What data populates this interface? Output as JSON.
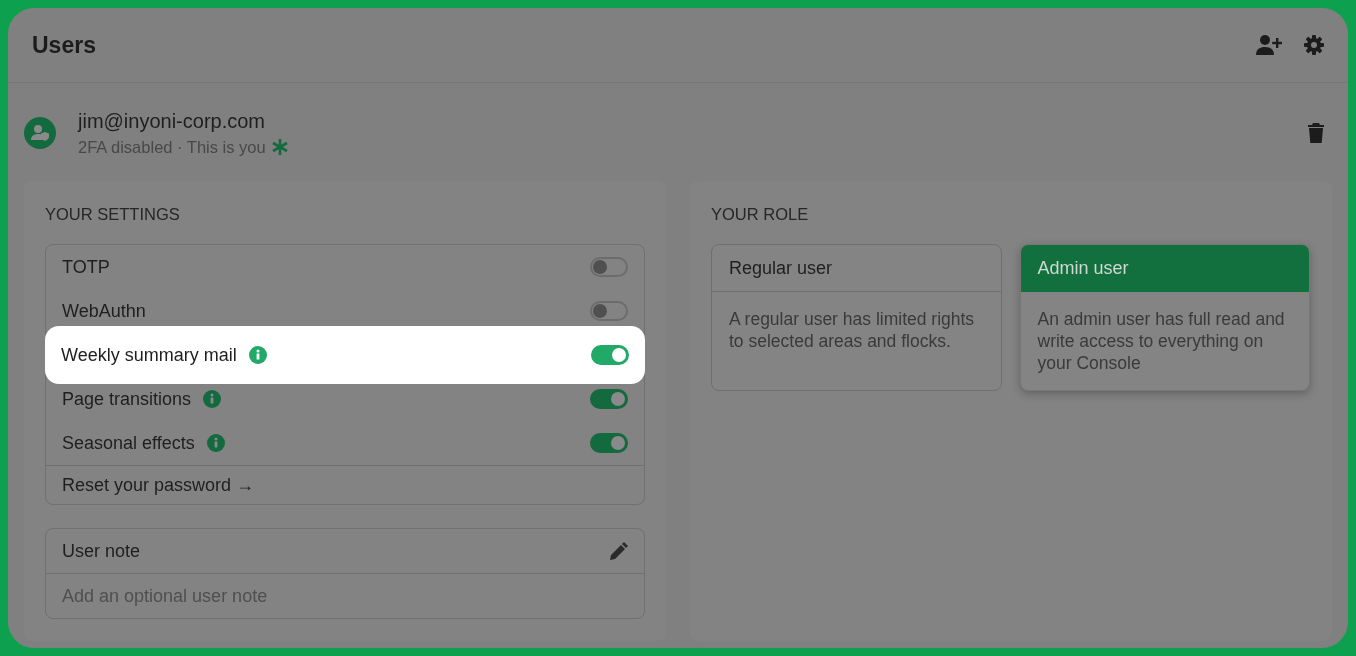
{
  "header": {
    "title": "Users"
  },
  "user": {
    "email": "jim@inyoni-corp.com",
    "status": "2FA disabled · This is you"
  },
  "settings": {
    "title": "YOUR SETTINGS",
    "items": [
      {
        "label": "TOTP",
        "on": false,
        "info": false,
        "highlighted": false
      },
      {
        "label": "WebAuthn",
        "on": false,
        "info": false,
        "highlighted": false
      },
      {
        "label": "Weekly summary mail",
        "on": true,
        "info": true,
        "highlighted": true
      },
      {
        "label": "Page transitions",
        "on": true,
        "info": true,
        "highlighted": false
      },
      {
        "label": "Seasonal effects",
        "on": true,
        "info": true,
        "highlighted": false
      }
    ],
    "link": "Reset your password →"
  },
  "note": {
    "title": "User note",
    "placeholder": "Add an optional user note"
  },
  "role": {
    "title": "YOUR ROLE",
    "options": [
      {
        "name": "Regular user",
        "description": "A regular user has limited rights to selected areas and flocks.",
        "selected": false
      },
      {
        "name": "Admin user",
        "description": "An admin user has full read and write access to everything on your Console",
        "selected": true
      }
    ]
  }
}
